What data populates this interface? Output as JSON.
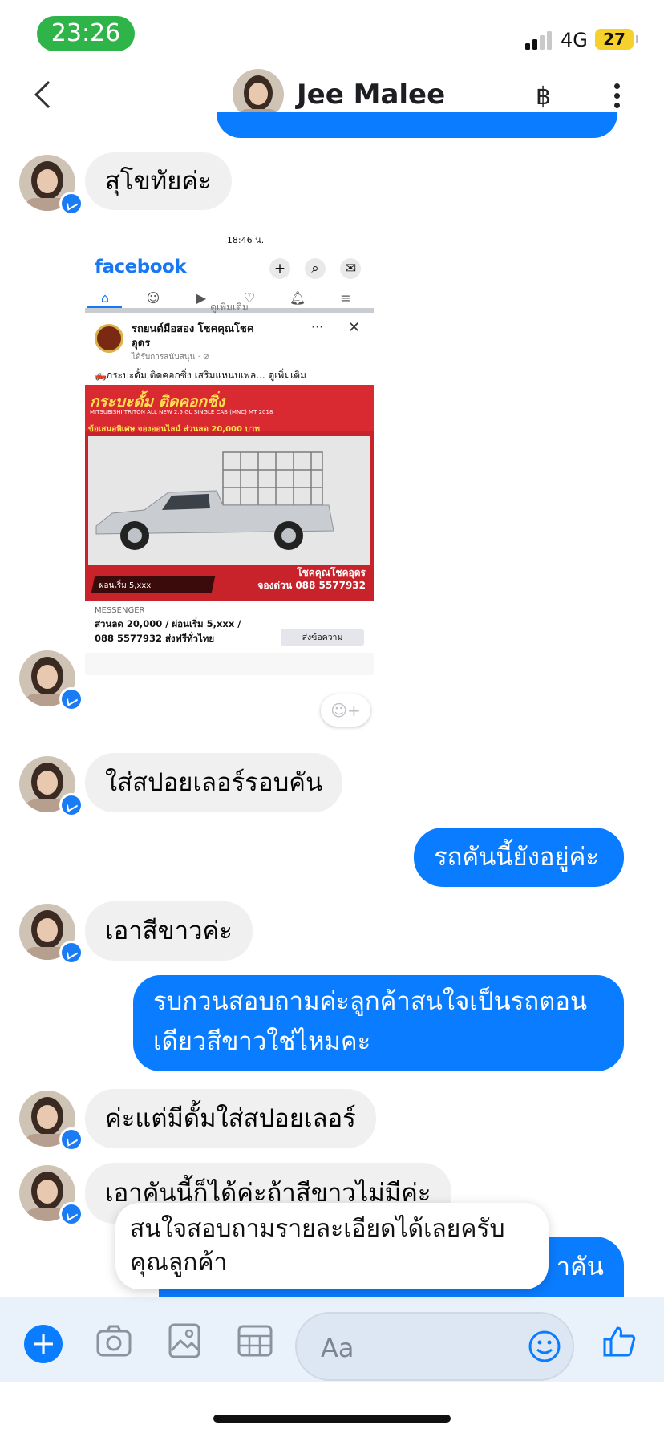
{
  "status_bar": {
    "time": "23:26",
    "network": "4G",
    "battery": "27"
  },
  "header": {
    "contact_name": "Jee Malee",
    "currency_icon": "฿"
  },
  "messages": [
    {
      "from": "them",
      "text": "สุโขทัยค่ะ"
    },
    {
      "from": "them",
      "text": "ใส่สปอยเลอร์รอบคัน"
    },
    {
      "from": "me",
      "text": "รถคันนี้ยังอยู่ค่ะ"
    },
    {
      "from": "them",
      "text": "เอาสีขาวค่ะ"
    },
    {
      "from": "me",
      "text": "รบกวนสอบถามค่ะลูกค้าสนใจเป็นรถตอนเดียวสีขาวใช่ไหมคะ"
    },
    {
      "from": "them",
      "text": "ค่ะแต่มีดั้มใส่สปอยเลอร์"
    },
    {
      "from": "them",
      "text": "เอาคันนี้ก็ได้ค่ะถ้าสีขาวไม่มีค่ะ"
    },
    {
      "from": "me",
      "text": "าคัน"
    }
  ],
  "shared_screenshot": {
    "status_time": "18:46 น.",
    "app": "facebook",
    "see_more": "ดูเพิ่มเติม",
    "page_name": "รถยนต์มือสอง โชคคุณโชค อุดร",
    "sponsored": "ได้รับการสนับสนุน · ⊘",
    "post_text": "🛻กระบะดั้ม ติดคอกซิ่ง เสริมแหนบเพล... ดูเพิ่มเติม",
    "ad_headline": "กระบะดั้ม ติดคอกซิ่ง",
    "ad_model": "MITSUBISHI TRITON ALL NEW 2.5 GL SINGLE CAB (MNC) MT 2018",
    "ad_promo": "ข้อเสนอพิเศษ จองออนไลน์ ส่วนลด 20,000 บาท",
    "ad_installment": "ผ่อนเริ่ม 5,xxx",
    "ad_dealer": "โชคคุณโชคอุดร",
    "ad_phone": "จองด่วน 088 5577932",
    "meta": "MESSENGER",
    "title": "ส่วนลด 20,000 / ผ่อนเริ่ม 5,xxx / 088 5577932 ส่งฟรีทั่วไทย",
    "cta": "ส่งข้อความ"
  },
  "overlay_text": "สนใจสอบถามรายละเอียดได้เลยครับ คุณลูกค้า",
  "composer": {
    "placeholder": "Aa"
  },
  "colors": {
    "outgoing": "#0a7cff",
    "incoming": "#f0f0f0",
    "status_pill": "#2fb44a",
    "battery": "#f6d12b"
  }
}
